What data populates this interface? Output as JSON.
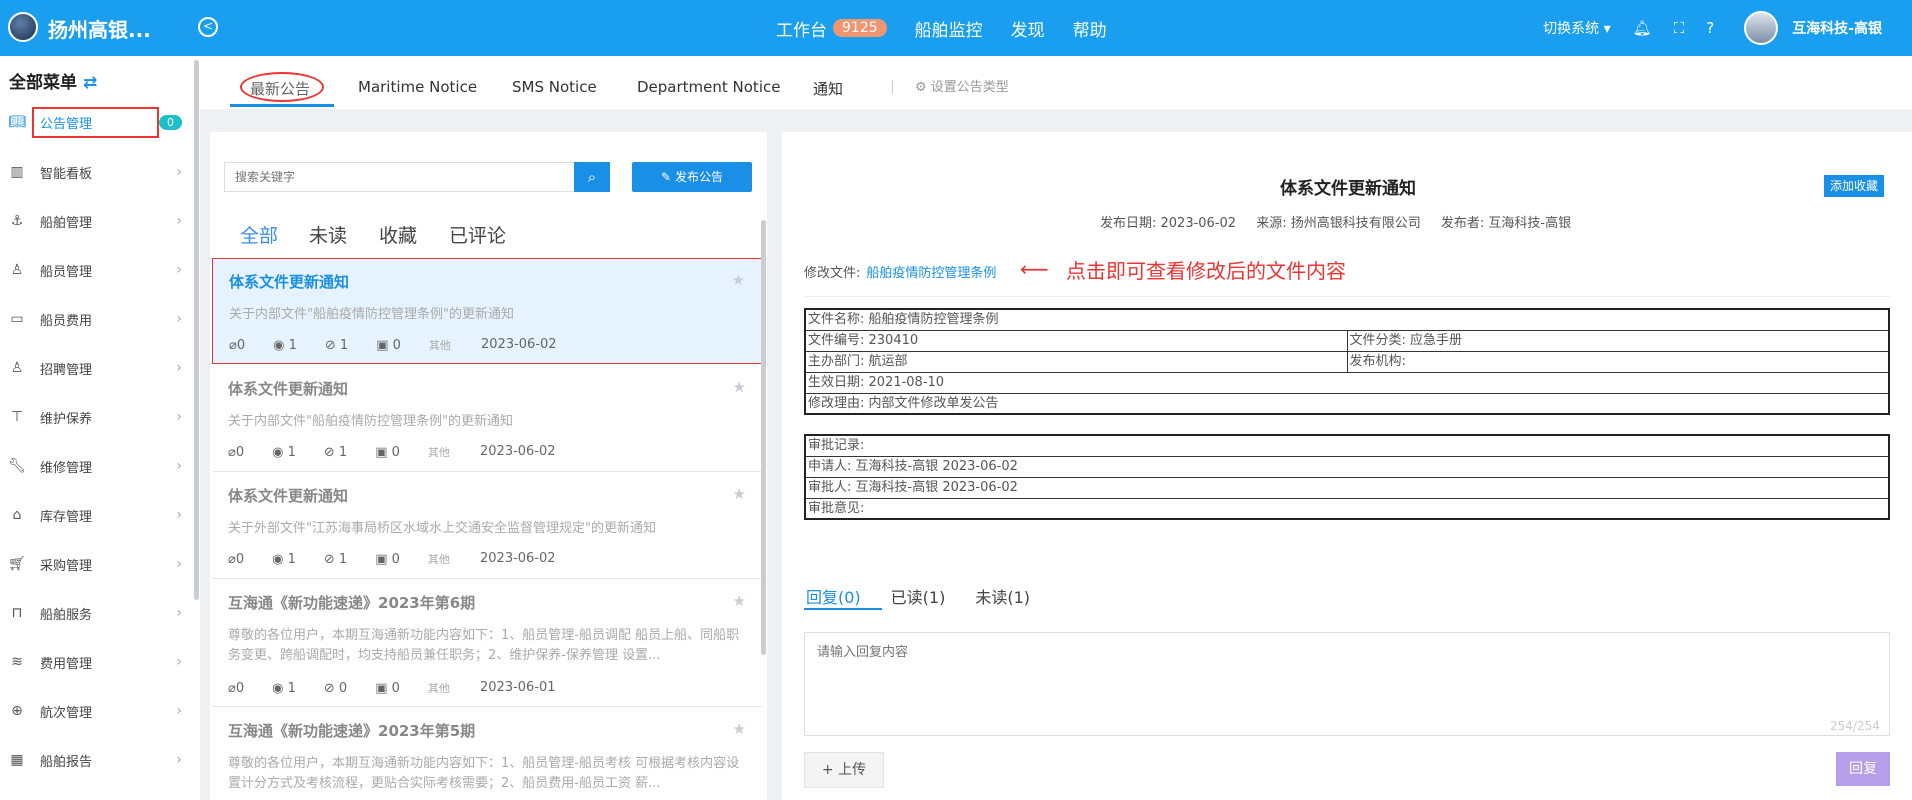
{
  "header": {
    "brand": "扬州高银...",
    "nav": [
      {
        "label": "工作台",
        "badge": "9125"
      },
      {
        "label": "船舶监控"
      },
      {
        "label": "发现"
      },
      {
        "label": "帮助"
      }
    ],
    "switch_system": "切换系统",
    "user_name": "互海科技-高银"
  },
  "sidebar": {
    "title": "全部菜单",
    "badge": "0",
    "items": [
      {
        "label": "公告管理",
        "icon": "book-icon",
        "active": true
      },
      {
        "label": "智能看板",
        "icon": "bar-chart-icon"
      },
      {
        "label": "船舶管理",
        "icon": "anchor-icon"
      },
      {
        "label": "船员管理",
        "icon": "person-icon"
      },
      {
        "label": "船员费用",
        "icon": "wallet-icon"
      },
      {
        "label": "招聘管理",
        "icon": "recruit-icon"
      },
      {
        "label": "维护保养",
        "icon": "brush-icon"
      },
      {
        "label": "维修管理",
        "icon": "wrench-icon"
      },
      {
        "label": "库存管理",
        "icon": "warehouse-icon"
      },
      {
        "label": "采购管理",
        "icon": "cart-icon"
      },
      {
        "label": "船舶服务",
        "icon": "paint-roller-icon"
      },
      {
        "label": "费用管理",
        "icon": "coins-icon"
      },
      {
        "label": "航次管理",
        "icon": "globe-icon"
      },
      {
        "label": "船舶报告",
        "icon": "calendar-icon"
      }
    ]
  },
  "tabs": {
    "items": [
      "最新公告",
      "Maritime Notice",
      "SMS Notice",
      "Department Notice",
      "通知"
    ],
    "settings": "设置公告类型"
  },
  "list": {
    "search_placeholder": "搜索关键字",
    "publish_label": "发布公告",
    "filters": [
      "全部",
      "未读",
      "收藏",
      "已评论"
    ],
    "items": [
      {
        "title": "体系文件更新通知",
        "summary": "关于内部文件\"船舶疫情防控管理条例\"的更新通知",
        "attachments": "0",
        "views": "1",
        "hidden": "1",
        "comments": "0",
        "category": "其他",
        "date": "2023-06-02"
      },
      {
        "title": "体系文件更新通知",
        "summary": "关于内部文件\"船舶疫情防控管理条例\"的更新通知",
        "attachments": "0",
        "views": "1",
        "hidden": "1",
        "comments": "0",
        "category": "其他",
        "date": "2023-06-02"
      },
      {
        "title": "体系文件更新通知",
        "summary": "关于外部文件\"江苏海事局桥区水域水上交通安全监督管理规定\"的更新通知",
        "attachments": "0",
        "views": "1",
        "hidden": "1",
        "comments": "0",
        "category": "其他",
        "date": "2023-06-02"
      },
      {
        "title": "互海通《新功能速递》2023年第6期",
        "summary": "尊敬的各位用户，本期互海通新功能内容如下：1、船员管理-船员调配 船员上船、同船职务变更、跨船调配时，均支持船员兼任职务；2、维护保养-保养管理 设置...",
        "attachments": "0",
        "views": "1",
        "hidden": "0",
        "comments": "0",
        "category": "其他",
        "date": "2023-06-01"
      },
      {
        "title": "互海通《新功能速递》2023年第5期",
        "summary": "尊敬的各位用户，本期互海通新功能内容如下：1、船员管理-船员考核 可根据考核内容设置计分方式及考核流程，更贴合实际考核需要；2、船员费用-船员工资 薪..."
      }
    ]
  },
  "detail": {
    "title": "体系文件更新通知",
    "favorite_label": "添加收藏",
    "publish_date": "发布日期: 2023-06-02",
    "source": "来源: 扬州高银科技有限公司",
    "publisher": "发布者: 互海科技-高银",
    "modified_file_label": "修改文件:",
    "modified_file_link": "船舶疫情防控管理条例",
    "annotation": "点击即可查看修改后的文件内容",
    "file_table": {
      "name": "文件名称:   船舶疫情防控管理条例",
      "number": "文件编号:   230410",
      "category": "文件分类:   应急手册",
      "department": "主办部门:   航运部",
      "agency": "发布机构:",
      "effective": "生效日期:   2021-08-10",
      "reason": "修改理由:   内部文件修改单发公告"
    },
    "approval_table": {
      "record": "审批记录:",
      "applicant": "申请人:  互海科技-高银    2023-06-02",
      "approver": "审批人:  互海科技-高银    2023-06-02",
      "opinion": "审批意见:"
    },
    "reply_tabs": [
      "回复(0)",
      "已读(1)",
      "未读(1)"
    ],
    "reply_placeholder": "请输入回复内容",
    "reply_counter": "254/254",
    "upload_label": "+ 上传",
    "reply_button": "回复"
  }
}
